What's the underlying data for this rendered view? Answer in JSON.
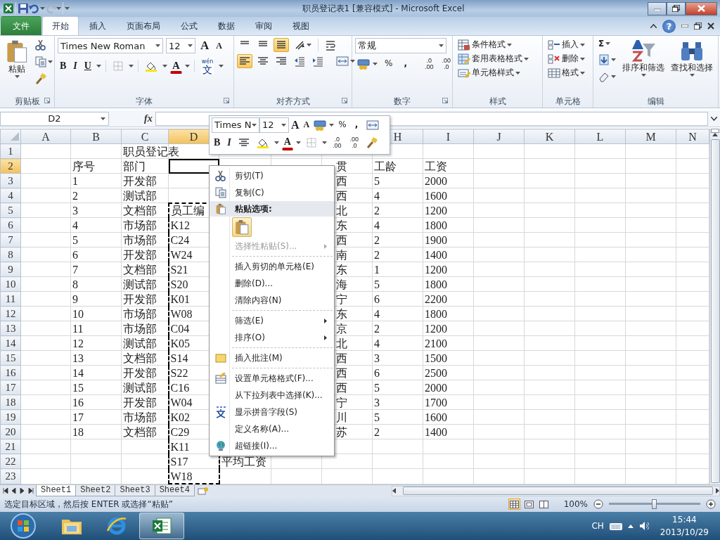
{
  "window": {
    "title": "职员登记表1  [兼容模式]  -  Microsoft Excel"
  },
  "tabs": [
    {
      "label": "文件",
      "kind": "file",
      "selected": false
    },
    {
      "label": "开始",
      "kind": "tab",
      "selected": true
    },
    {
      "label": "插入",
      "kind": "tab",
      "selected": false
    },
    {
      "label": "页面布局",
      "kind": "tab",
      "selected": false
    },
    {
      "label": "公式",
      "kind": "tab",
      "selected": false
    },
    {
      "label": "数据",
      "kind": "tab",
      "selected": false
    },
    {
      "label": "审阅",
      "kind": "tab",
      "selected": false
    },
    {
      "label": "视图",
      "kind": "tab",
      "selected": false
    }
  ],
  "help": "?",
  "ribbon": {
    "clipboard": {
      "paste": "粘贴",
      "group_label": "剪贴板"
    },
    "font": {
      "font_name": "Times New Roman",
      "font_size": "12",
      "grow": "A",
      "shrink": "A",
      "bold": "B",
      "italic": "I",
      "underline": "U",
      "font_color": "A",
      "phonetic_caption": "wén",
      "phonetic_char": "文",
      "group_label": "字体"
    },
    "alignment": {
      "vertical": [
        {
          "selected": false
        },
        {
          "selected": false
        },
        {
          "selected": true
        }
      ],
      "horizontal": [
        {
          "selected": true
        },
        {
          "selected": false
        },
        {
          "selected": false
        }
      ],
      "group_label": "对齐方式"
    },
    "number": {
      "format": "常规",
      "percent": "%",
      "comma": ",",
      "decimal_increase": [
        ".0",
        ".00"
      ],
      "decimal_decrease": [
        ".00",
        ".0"
      ],
      "group_label": "数字"
    },
    "styles": {
      "items": [
        "条件格式",
        "套用表格格式",
        "单元格样式"
      ],
      "group_label": "样式"
    },
    "cells": {
      "items": [
        "插入",
        "删除",
        "格式"
      ],
      "group_label": "单元格"
    },
    "editing": {
      "sum": "Σ",
      "sort_filter": "排序和筛选",
      "find_select": "查找和选择",
      "group_label": "编辑"
    }
  },
  "formula_bar": {
    "name_box": "D2",
    "fx": "fx"
  },
  "columns": [
    {
      "label": "A",
      "selected": false
    },
    {
      "label": "B",
      "selected": false
    },
    {
      "label": "C",
      "selected": false
    },
    {
      "label": "D",
      "selected": true
    },
    {},
    {},
    {},
    {
      "label": "H",
      "selected": false
    },
    {
      "label": "I",
      "selected": false
    },
    {
      "label": "J",
      "selected": false
    },
    {
      "label": "K",
      "selected": false
    },
    {
      "label": "L",
      "selected": false
    },
    {
      "label": "M",
      "selected": false
    },
    {
      "label": "N",
      "selected": false
    }
  ],
  "rows": [
    {
      "label": "1",
      "selected": false,
      "cells": {
        "C": "职员登记表"
      }
    },
    {
      "label": "2",
      "selected": true,
      "cells": {
        "B": "序号",
        "C": "部门",
        "G": "贯",
        "H": "工龄",
        "I": "工资"
      }
    },
    {
      "label": "3",
      "selected": false,
      "cells": {
        "B": "1",
        "C": "开发部",
        "G": "西",
        "H": "5",
        "I": "2000"
      }
    },
    {
      "label": "4",
      "selected": false,
      "cells": {
        "B": "2",
        "C": "测试部",
        "G": "西",
        "H": "4",
        "I": "1600"
      }
    },
    {
      "label": "5",
      "selected": false,
      "cells": {
        "B": "3",
        "C": "文档部",
        "D": {
          "text": "员工编",
          "marquee": true
        },
        "G": "北",
        "H": "2",
        "I": "1200"
      }
    },
    {
      "label": "6",
      "selected": false,
      "cells": {
        "B": "4",
        "C": "市场部",
        "D": {
          "text": "K12",
          "marquee": true
        },
        "G": "东",
        "H": "4",
        "I": "1800"
      }
    },
    {
      "label": "7",
      "selected": false,
      "cells": {
        "B": "5",
        "C": "市场部",
        "D": {
          "text": "C24",
          "marquee": true
        },
        "G": "西",
        "H": "2",
        "I": "1900"
      }
    },
    {
      "label": "8",
      "selected": false,
      "cells": {
        "B": "6",
        "C": "开发部",
        "D": {
          "text": "W24",
          "marquee": true
        },
        "G": "南",
        "H": "2",
        "I": "1400"
      }
    },
    {
      "label": "9",
      "selected": false,
      "cells": {
        "B": "7",
        "C": "文档部",
        "D": {
          "text": "S21",
          "marquee": true
        },
        "G": "东",
        "H": "1",
        "I": "1200"
      }
    },
    {
      "label": "10",
      "selected": false,
      "cells": {
        "B": "8",
        "C": "测试部",
        "D": {
          "text": "S20",
          "marquee": true
        },
        "G": "海",
        "H": "5",
        "I": "1800"
      }
    },
    {
      "label": "11",
      "selected": false,
      "cells": {
        "B": "9",
        "C": "开发部",
        "D": {
          "text": "K01",
          "marquee": true
        },
        "G": "宁",
        "H": "6",
        "I": "2200"
      }
    },
    {
      "label": "12",
      "selected": false,
      "cells": {
        "B": "10",
        "C": "市场部",
        "D": {
          "text": "W08",
          "marquee": true
        },
        "G": "东",
        "H": "4",
        "I": "1800"
      }
    },
    {
      "label": "13",
      "selected": false,
      "cells": {
        "B": "11",
        "C": "市场部",
        "D": {
          "text": "C04",
          "marquee": true
        },
        "G": "京",
        "H": "2",
        "I": "1200"
      }
    },
    {
      "label": "14",
      "selected": false,
      "cells": {
        "B": "12",
        "C": "测试部",
        "D": {
          "text": "K05",
          "marquee": true
        },
        "G": "北",
        "H": "4",
        "I": "2100"
      }
    },
    {
      "label": "15",
      "selected": false,
      "cells": {
        "B": "13",
        "C": "文档部",
        "D": {
          "text": "S14",
          "marquee": true
        },
        "G": "西",
        "H": "3",
        "I": "1500"
      }
    },
    {
      "label": "16",
      "selected": false,
      "cells": {
        "B": "14",
        "C": "开发部",
        "D": {
          "text": "S22",
          "marquee": true
        },
        "G": "西",
        "H": "6",
        "I": "2500"
      }
    },
    {
      "label": "17",
      "selected": false,
      "cells": {
        "B": "15",
        "C": "测试部",
        "D": {
          "text": "C16",
          "marquee": true
        },
        "G": "西",
        "H": "5",
        "I": "2000"
      }
    },
    {
      "label": "18",
      "selected": false,
      "cells": {
        "B": "16",
        "C": "开发部",
        "D": {
          "text": "W04",
          "marquee": true
        },
        "G": "宁",
        "H": "3",
        "I": "1700"
      }
    },
    {
      "label": "19",
      "selected": false,
      "cells": {
        "B": "17",
        "C": "市场部",
        "D": {
          "text": "K02",
          "marquee": true
        },
        "G": "川",
        "H": "5",
        "I": "1600"
      }
    },
    {
      "label": "20",
      "selected": false,
      "cells": {
        "B": "18",
        "C": "文档部",
        "D": {
          "text": "C29",
          "marquee": true
        },
        "G": "苏",
        "H": "2",
        "I": "1400"
      }
    },
    {
      "label": "21",
      "selected": false,
      "cells": {
        "D": {
          "text": "K11",
          "marquee": true
        }
      }
    },
    {
      "label": "22",
      "selected": false,
      "cells": {
        "D": {
          "text": "S17",
          "marquee": true
        },
        "E": "平均工资"
      }
    },
    {
      "label": "23",
      "selected": false,
      "cells": {
        "D": {
          "text": "W18",
          "marquee": true
        }
      }
    }
  ],
  "mini_toolbar": {
    "font_name": "Times N",
    "font_size": "12",
    "grow": "A",
    "shrink": "A",
    "percent": "%",
    "comma": ",",
    "bold": "B",
    "italic": "I",
    "font_color": "A",
    "decimal_increase": [
      ".0",
      ".00"
    ],
    "decimal_decrease": [
      ".00",
      ".0"
    ]
  },
  "context_menu": [
    {
      "kind": "item",
      "label": "剪切(T)",
      "disabled": false,
      "submenu": false
    },
    {
      "kind": "item",
      "label": "复制(C)",
      "disabled": false,
      "submenu": false
    },
    {
      "kind": "header",
      "label": "粘贴选项:"
    },
    {
      "kind": "paste_options"
    },
    {
      "kind": "item",
      "label": "选择性粘贴(S)...",
      "disabled": true,
      "submenu": true
    },
    {
      "kind": "separator"
    },
    {
      "kind": "item",
      "label": "插入剪切的单元格(E)",
      "disabled": false,
      "submenu": false
    },
    {
      "kind": "item",
      "label": "删除(D)...",
      "disabled": false,
      "submenu": false
    },
    {
      "kind": "item",
      "label": "清除内容(N)",
      "disabled": false,
      "submenu": false
    },
    {
      "kind": "separator"
    },
    {
      "kind": "item",
      "label": "筛选(E)",
      "disabled": false,
      "submenu": true
    },
    {
      "kind": "item",
      "label": "排序(O)",
      "disabled": false,
      "submenu": true
    },
    {
      "kind": "separator"
    },
    {
      "kind": "item",
      "label": "插入批注(M)",
      "disabled": false,
      "submenu": false
    },
    {
      "kind": "separator"
    },
    {
      "kind": "item",
      "label": "设置单元格格式(F)...",
      "disabled": false,
      "submenu": false
    },
    {
      "kind": "item",
      "label": "从下拉列表中选择(K)...",
      "disabled": false,
      "submenu": false
    },
    {
      "kind": "item",
      "label": "显示拼音字段(S)",
      "disabled": false,
      "submenu": false
    },
    {
      "kind": "item",
      "label": "定义名称(A)...",
      "disabled": false,
      "submenu": false
    },
    {
      "kind": "item",
      "label": "超链接(I)...",
      "disabled": false,
      "submenu": false
    }
  ],
  "sheet_tabs": [
    {
      "label": "Sheet1",
      "selected": true
    },
    {
      "label": "Sheet2",
      "selected": false
    },
    {
      "label": "Sheet3",
      "selected": false
    },
    {
      "label": "Sheet4",
      "selected": false
    }
  ],
  "status_bar": {
    "message": "选定目标区域，然后按 ENTER 或选择“粘贴”",
    "views": [
      {
        "selected": true
      },
      {
        "selected": false
      },
      {
        "selected": false
      }
    ],
    "zoom": "100%",
    "zoom_slider": {
      "level": 0.5
    }
  },
  "taskbar": {
    "apps": [
      {
        "selected": false
      },
      {
        "selected": false
      },
      {
        "selected": true
      }
    ],
    "language": "CH",
    "time": "15:44",
    "date": "2013/10/29"
  }
}
